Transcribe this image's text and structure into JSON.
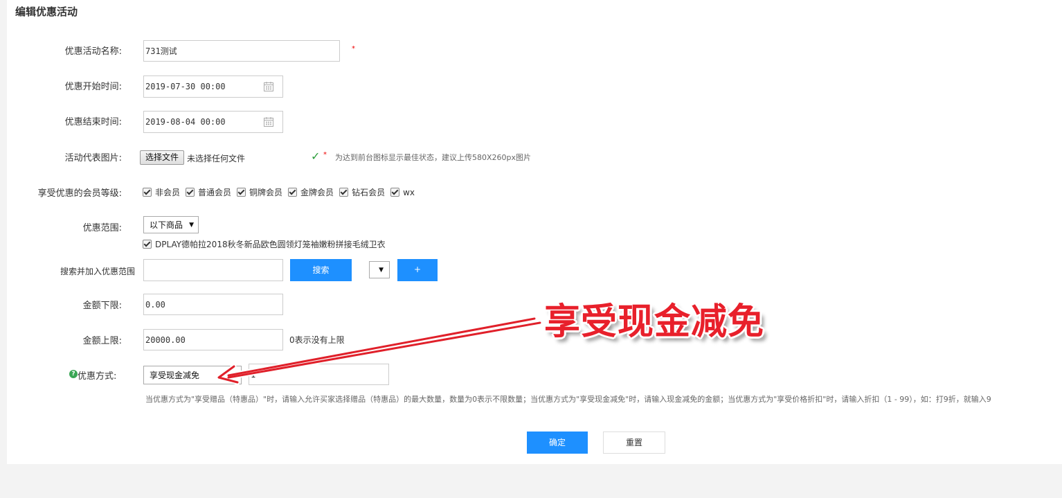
{
  "page_title": "编辑优惠活动",
  "fields": {
    "name": {
      "label": "优惠活动名称:",
      "value": "731测试",
      "required_mark": "*"
    },
    "start_time": {
      "label": "优惠开始时间:",
      "value": "2019-07-30 00:00"
    },
    "end_time": {
      "label": "优惠结束时间:",
      "value": "2019-08-04 00:00"
    },
    "image": {
      "label": "活动代表图片:",
      "button_label": "选择文件",
      "file_status": "未选择任何文件",
      "ok_mark": "✓",
      "required_mark": "*",
      "hint": "为达到前台图标显示最佳状态，建议上传580X260px图片"
    },
    "member_levels": {
      "label": "享受优惠的会员等级:",
      "options": [
        "非会员",
        "普通会员",
        "铜牌会员",
        "金牌会员",
        "钻石会员",
        "wx"
      ]
    },
    "scope": {
      "label": "优惠范围:",
      "selected": "以下商品",
      "product": "DPLAY德帕拉2018秋冬新品欧色圆领灯笼袖嫩粉拼接毛绒卫衣"
    },
    "search": {
      "label": "搜索并加入优惠范围",
      "value": "",
      "search_button": "搜索",
      "add_button": "+"
    },
    "min_amount": {
      "label": "金额下限:",
      "value": "0.00"
    },
    "max_amount": {
      "label": "金额上限:",
      "value": "20000.00",
      "note": "0表示没有上限"
    },
    "method": {
      "label": "优惠方式:",
      "selected": "享受现金减免",
      "value": "1",
      "help_icon": "?"
    }
  },
  "method_hint": "当优惠方式为\"享受赠品（特惠品）\"时，请输入允许买家选择赠品（特惠品）的最大数量，数量为0表示不限数量；当优惠方式为\"享受现金减免\"时，请输入现金减免的金额；当优惠方式为\"享受价格折扣\"时，请输入折扣（1 - 99），如：打9折，就输入9",
  "buttons": {
    "confirm": "确定",
    "reset": "重置"
  },
  "annotation": {
    "text": "享受现金减免",
    "color": "#e8202b"
  },
  "colors": {
    "primary": "#1e90ff",
    "success": "#2a9d3a",
    "required": "#ee0000"
  }
}
